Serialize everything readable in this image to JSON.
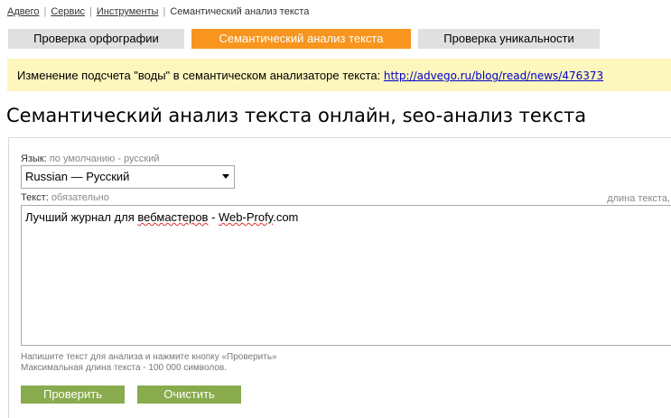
{
  "breadcrumb": [
    {
      "label": "Адвего"
    },
    {
      "label": "Сервис"
    },
    {
      "label": "Инструменты"
    },
    {
      "label": "Семантический анализ текста"
    }
  ],
  "tabs": [
    {
      "label": "Проверка орфографии"
    },
    {
      "label": "Семантический анализ текста"
    },
    {
      "label": "Проверка уникальности"
    }
  ],
  "notice": {
    "text": "Изменение подсчета \"воды\" в семантическом анализаторе текста: ",
    "link": "http://advego.ru/blog/read/news/476373"
  },
  "page_title": "Семантический анализ текста онлайн, seo-анализ текста",
  "form": {
    "language": {
      "label": "Язык:",
      "hint": "по умолчанию - русский",
      "selected": "Russian — Русский"
    },
    "text": {
      "label": "Текст:",
      "hint": "обязательно",
      "length_label": "длина текста,",
      "value_parts": [
        "Лучший журнал для ",
        "вебмастеров",
        " - ",
        "Web-Profy",
        ".com"
      ]
    },
    "help_line1": "Напишите текст для анализа и нажмите кнопку «Проверить»",
    "help_line2": "Максимальная длина текста - 100 000 символов.",
    "check_button": "Проверить",
    "clear_button": "Очистить"
  },
  "colors": {
    "active_tab": "#f7951e",
    "inactive_tab": "#e0e0e0",
    "notice_bg": "#fdf6bd",
    "button_bg": "#88ab4d",
    "link": "#0000cc"
  }
}
